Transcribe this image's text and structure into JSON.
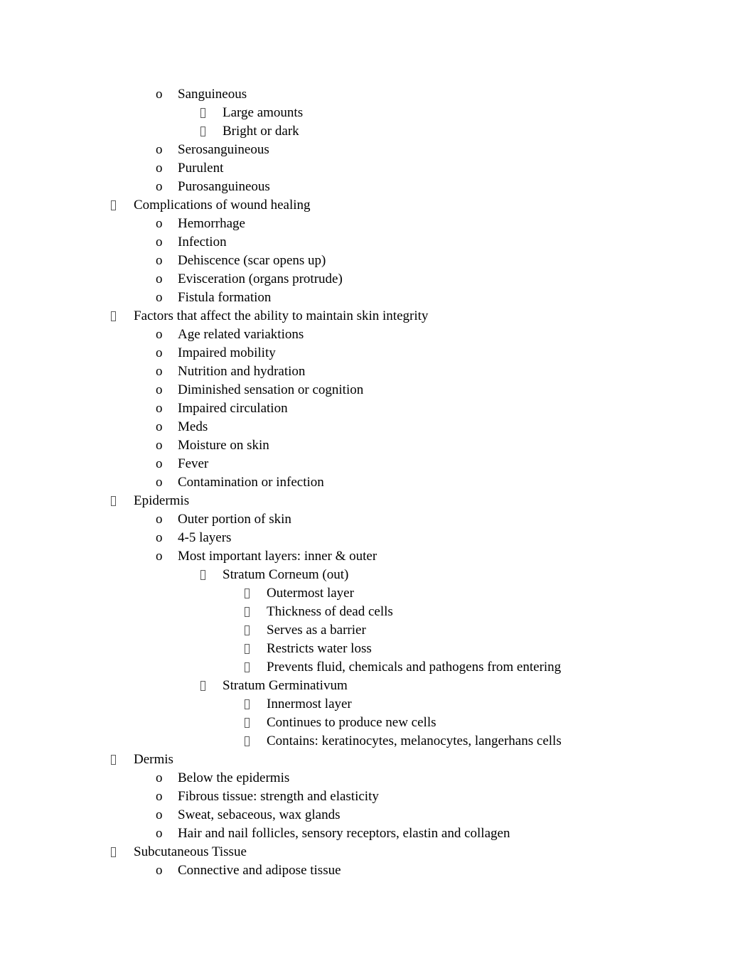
{
  "document": {
    "type": "outline-notes",
    "page_background": "#ffffff",
    "text_color": "#000000",
    "bullet_glyphs": {
      "level1": "tofu-box",
      "level2": "o",
      "level3": "tofu-box",
      "level4": "tofu-box"
    },
    "lines": [
      {
        "level": 2,
        "marker": "o",
        "text": "Sanguineous"
      },
      {
        "level": 3,
        "marker": "tofu",
        "text": "Large amounts"
      },
      {
        "level": 3,
        "marker": "tofu",
        "text": "Bright or dark"
      },
      {
        "level": 2,
        "marker": "o",
        "text": "Serosanguineous"
      },
      {
        "level": 2,
        "marker": "o",
        "text": "Purulent"
      },
      {
        "level": 2,
        "marker": "o",
        "text": "Purosanguineous"
      },
      {
        "level": 1,
        "marker": "tofu",
        "text": "Complications of wound healing"
      },
      {
        "level": 2,
        "marker": "o",
        "text": "Hemorrhage"
      },
      {
        "level": 2,
        "marker": "o",
        "text": "Infection"
      },
      {
        "level": 2,
        "marker": "o",
        "text": "Dehiscence (scar opens up)"
      },
      {
        "level": 2,
        "marker": "o",
        "text": "Evisceration (organs protrude)"
      },
      {
        "level": 2,
        "marker": "o",
        "text": "Fistula formation"
      },
      {
        "level": 1,
        "marker": "tofu",
        "text": "Factors that affect the ability to maintain skin integrity"
      },
      {
        "level": 2,
        "marker": "o",
        "text": "Age related variaktions"
      },
      {
        "level": 2,
        "marker": "o",
        "text": "Impaired mobility"
      },
      {
        "level": 2,
        "marker": "o",
        "text": "Nutrition and hydration"
      },
      {
        "level": 2,
        "marker": "o",
        "text": "Diminished sensation or cognition"
      },
      {
        "level": 2,
        "marker": "o",
        "text": "Impaired circulation"
      },
      {
        "level": 2,
        "marker": "o",
        "text": "Meds"
      },
      {
        "level": 2,
        "marker": "o",
        "text": "Moisture on skin"
      },
      {
        "level": 2,
        "marker": "o",
        "text": "Fever"
      },
      {
        "level": 2,
        "marker": "o",
        "text": "Contamination or infection"
      },
      {
        "level": 1,
        "marker": "tofu",
        "text": "Epidermis"
      },
      {
        "level": 2,
        "marker": "o",
        "text": "Outer portion of skin"
      },
      {
        "level": 2,
        "marker": "o",
        "text": "4-5 layers"
      },
      {
        "level": 2,
        "marker": "o",
        "text": "Most important layers: inner & outer"
      },
      {
        "level": 3,
        "marker": "tofu",
        "text": "Stratum Corneum (out)"
      },
      {
        "level": 4,
        "marker": "tofu",
        "text": "Outermost layer"
      },
      {
        "level": 4,
        "marker": "tofu",
        "text": "Thickness of dead cells"
      },
      {
        "level": 4,
        "marker": "tofu",
        "text": "Serves as a barrier"
      },
      {
        "level": 4,
        "marker": "tofu",
        "text": "Restricts water loss"
      },
      {
        "level": 4,
        "marker": "tofu",
        "text": "Prevents fluid, chemicals and pathogens from entering"
      },
      {
        "level": 3,
        "marker": "tofu",
        "text": "Stratum Germinativum"
      },
      {
        "level": 4,
        "marker": "tofu",
        "text": "Innermost layer"
      },
      {
        "level": 4,
        "marker": "tofu",
        "text": "Continues to produce new cells"
      },
      {
        "level": 4,
        "marker": "tofu",
        "text": "Contains: keratinocytes, melanocytes, langerhans cells"
      },
      {
        "level": 1,
        "marker": "tofu",
        "text": "Dermis"
      },
      {
        "level": 2,
        "marker": "o",
        "text": "Below the epidermis"
      },
      {
        "level": 2,
        "marker": "o",
        "text": "Fibrous tissue: strength and elasticity"
      },
      {
        "level": 2,
        "marker": "o",
        "text": "Sweat, sebaceous, wax glands"
      },
      {
        "level": 2,
        "marker": "o",
        "text": "Hair and nail follicles, sensory receptors, elastin and collagen"
      },
      {
        "level": 1,
        "marker": "tofu",
        "text": "Subcutaneous Tissue"
      },
      {
        "level": 2,
        "marker": "o",
        "text": "Connective and adipose tissue"
      }
    ]
  }
}
